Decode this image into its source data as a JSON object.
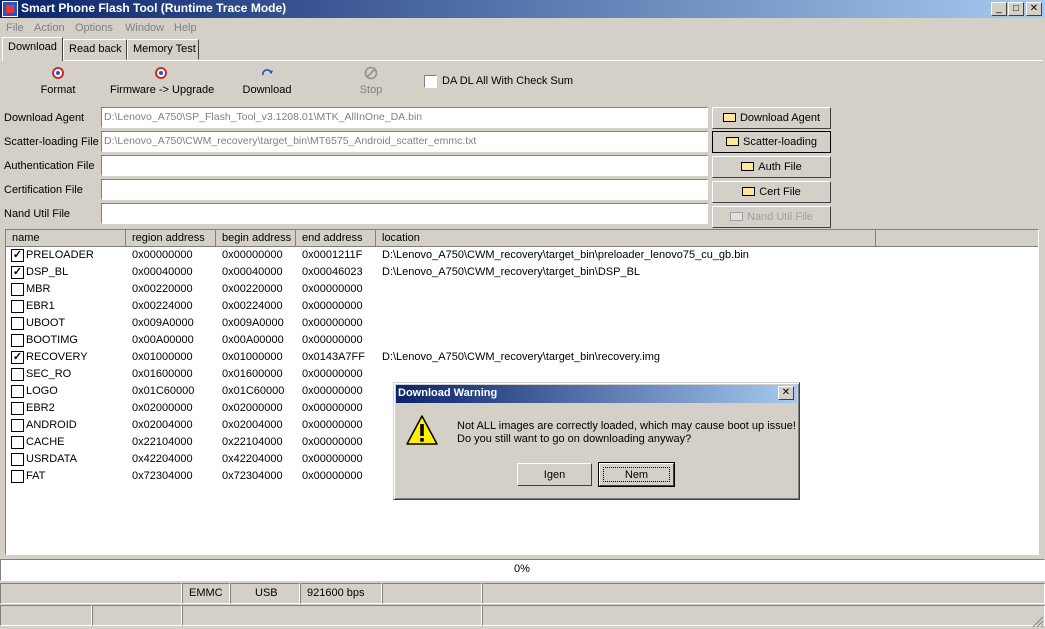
{
  "window": {
    "title": "Smart Phone Flash Tool (Runtime Trace Mode)",
    "minimize": "_",
    "maximize": "□",
    "close": "✕"
  },
  "menu": [
    "File",
    "Action",
    "Options",
    "Window",
    "Help"
  ],
  "tabs": [
    "Download",
    "Read back",
    "Memory Test"
  ],
  "toolbar": {
    "format": "Format",
    "firmware_upgrade": "Firmware -> Upgrade",
    "download": "Download",
    "stop": "Stop",
    "da_checksum_label": "DA DL All With Check Sum"
  },
  "files": [
    {
      "label": "Download Agent",
      "value": "D:\\Lenovo_A750\\SP_Flash_Tool_v3.1208.01\\MTK_AllInOne_DA.bin",
      "button": "Download Agent"
    },
    {
      "label": "Scatter-loading File",
      "value": "D:\\Lenovo_A750\\CWM_recovery\\target_bin\\MT6575_Android_scatter_emmc.txt",
      "button": "Scatter-loading"
    },
    {
      "label": "Authentication File",
      "value": "",
      "button": "Auth File"
    },
    {
      "label": "Certification File",
      "value": "",
      "button": "Cert File"
    },
    {
      "label": "Nand Util File",
      "value": "",
      "button": "Nand Util File"
    }
  ],
  "table": {
    "headers": [
      "name",
      "region address",
      "begin address",
      "end address",
      "location"
    ],
    "rows": [
      {
        "checked": true,
        "name": "PRELOADER",
        "region": "0x00000000",
        "begin": "0x00000000",
        "end": "0x0001211F",
        "location": "D:\\Lenovo_A750\\CWM_recovery\\target_bin\\preloader_lenovo75_cu_gb.bin"
      },
      {
        "checked": true,
        "name": "DSP_BL",
        "region": "0x00040000",
        "begin": "0x00040000",
        "end": "0x00046023",
        "location": "D:\\Lenovo_A750\\CWM_recovery\\target_bin\\DSP_BL"
      },
      {
        "checked": false,
        "name": "MBR",
        "region": "0x00220000",
        "begin": "0x00220000",
        "end": "0x00000000",
        "location": ""
      },
      {
        "checked": false,
        "name": "EBR1",
        "region": "0x00224000",
        "begin": "0x00224000",
        "end": "0x00000000",
        "location": ""
      },
      {
        "checked": false,
        "name": "UBOOT",
        "region": "0x009A0000",
        "begin": "0x009A0000",
        "end": "0x00000000",
        "location": ""
      },
      {
        "checked": false,
        "name": "BOOTIMG",
        "region": "0x00A00000",
        "begin": "0x00A00000",
        "end": "0x00000000",
        "location": ""
      },
      {
        "checked": true,
        "name": "RECOVERY",
        "region": "0x01000000",
        "begin": "0x01000000",
        "end": "0x0143A7FF",
        "location": "D:\\Lenovo_A750\\CWM_recovery\\target_bin\\recovery.img"
      },
      {
        "checked": false,
        "name": "SEC_RO",
        "region": "0x01600000",
        "begin": "0x01600000",
        "end": "0x00000000",
        "location": ""
      },
      {
        "checked": false,
        "name": "LOGO",
        "region": "0x01C60000",
        "begin": "0x01C60000",
        "end": "0x00000000",
        "location": ""
      },
      {
        "checked": false,
        "name": "EBR2",
        "region": "0x02000000",
        "begin": "0x02000000",
        "end": "0x00000000",
        "location": ""
      },
      {
        "checked": false,
        "name": "ANDROID",
        "region": "0x02004000",
        "begin": "0x02004000",
        "end": "0x00000000",
        "location": ""
      },
      {
        "checked": false,
        "name": "CACHE",
        "region": "0x22104000",
        "begin": "0x22104000",
        "end": "0x00000000",
        "location": ""
      },
      {
        "checked": false,
        "name": "USRDATA",
        "region": "0x42204000",
        "begin": "0x42204000",
        "end": "0x00000000",
        "location": ""
      },
      {
        "checked": false,
        "name": "FAT",
        "region": "0x72304000",
        "begin": "0x72304000",
        "end": "0x00000000",
        "location": ""
      }
    ]
  },
  "progress": {
    "percent": 0,
    "text": "0%"
  },
  "status": {
    "storage": "EMMC",
    "port": "USB",
    "baud": "921600 bps"
  },
  "dialog": {
    "title": "Download Warning",
    "close": "✕",
    "line1": "Not ALL images are correctly loaded, which may cause boot up issue!",
    "line2": "Do you still want to go on downloading anyway?",
    "yes": "Igen",
    "no": "Nem"
  },
  "icons": {
    "format": "format-icon",
    "firmware": "firmware-upgrade-icon",
    "download": "download-icon",
    "stop": "stop-icon",
    "warning": "warning-icon",
    "folder": "folder-icon"
  }
}
